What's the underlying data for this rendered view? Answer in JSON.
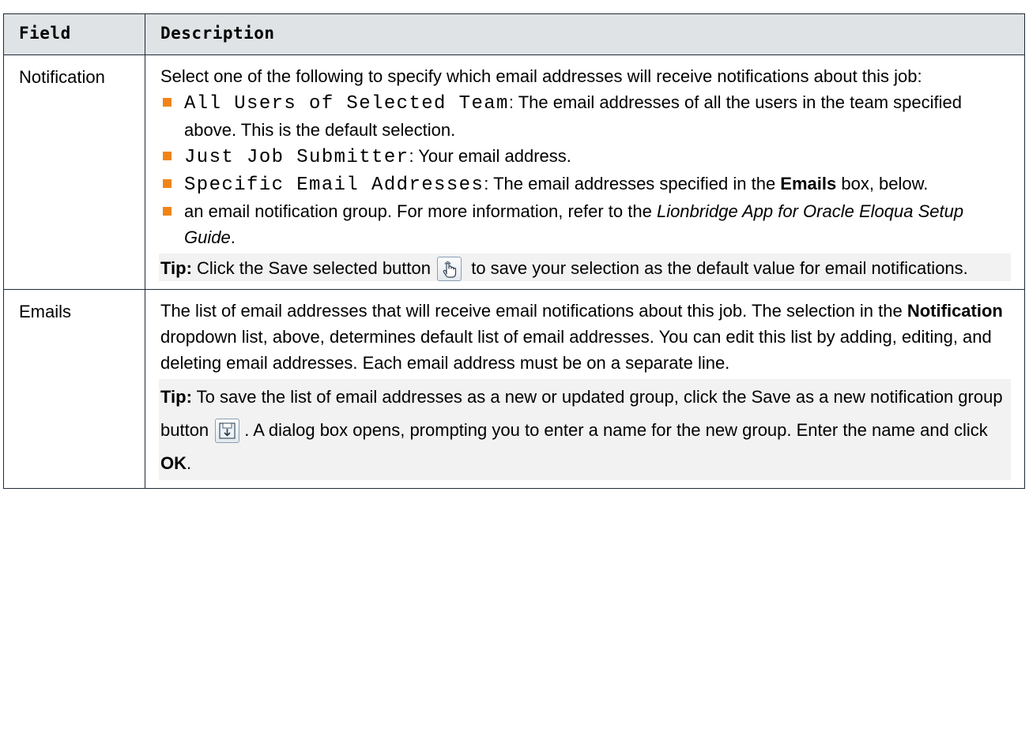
{
  "table": {
    "header": {
      "field": "Field",
      "description": "Description"
    },
    "rows": [
      {
        "field": "Notification",
        "intro": "Select one of the following to specify which email addresses will receive notifications about this job:",
        "options": [
          {
            "name": "All Users of Selected Team",
            "text": ": The email addresses of all the users in the team specified above. This is the default selection."
          },
          {
            "name": "Just Job Submitter",
            "text": ": Your email address."
          },
          {
            "name": "Specific Email Addresses",
            "text_before": ": The email addresses specified in the ",
            "bold": "Emails",
            "text_after": " box, below."
          },
          {
            "text_before": "an email notification group. For more information, refer to the ",
            "italic": "Lionbridge App for Oracle Eloqua Setup Guide",
            "text_after": "."
          }
        ],
        "tip": {
          "label": "Tip:",
          "before": " Click the Save selected button ",
          "after": " to save your selection as the default value for email notifications.",
          "icon": "hand-pointer-icon"
        }
      },
      {
        "field": "Emails",
        "desc_1": "The list of email addresses that will receive email notifications about this job. The selection in the ",
        "desc_bold": "Notification",
        "desc_2": " dropdown list, above, determines default list of email addresses. You can edit this list by adding, editing, and deleting email addresses. Each email address must be on a separate line.",
        "tip": {
          "label": "Tip:",
          "before": " To save the list of email addresses as a new or updated group, click the Save as a new notification group button ",
          "middle": ". A dialog box opens, prompting you to enter a name for the new group. Enter the name and click ",
          "bold": "OK",
          "end": ".",
          "icon": "save-group-icon"
        }
      }
    ]
  },
  "colors": {
    "bullet": "#f08419",
    "header_bg": "#dfe3e6",
    "tip_bg": "#f2f2f2",
    "border": "#1f2a36"
  }
}
